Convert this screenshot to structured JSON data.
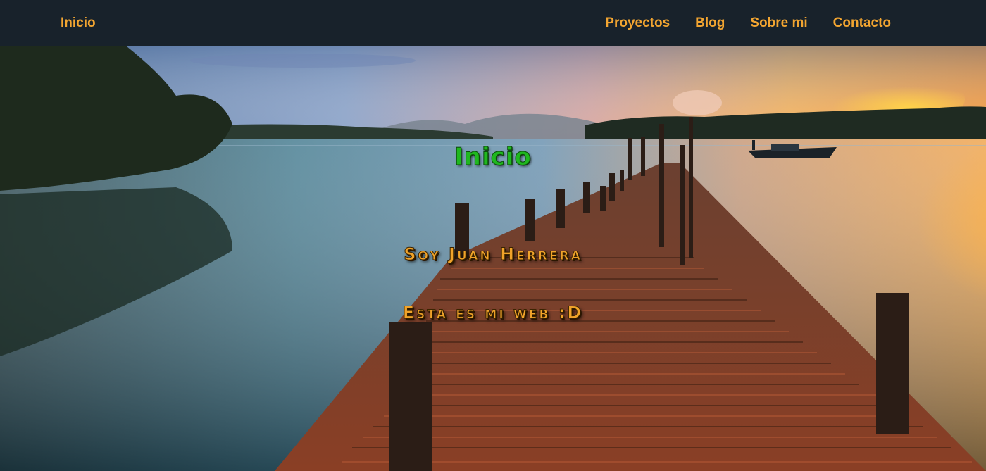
{
  "nav": {
    "home": "Inicio",
    "items": [
      {
        "label": "Proyectos"
      },
      {
        "label": "Blog"
      },
      {
        "label": "Sobre mi"
      },
      {
        "label": "Contacto"
      }
    ]
  },
  "hero": {
    "title": "Inicio",
    "name": "Soy Juan Herrera",
    "tagline": "Esta es mi web :D"
  },
  "colors": {
    "navbar_bg": "#18222b",
    "nav_link": "#f2a531",
    "title_green": "#1fb81f",
    "subtitle_orange": "#f0a32a"
  }
}
